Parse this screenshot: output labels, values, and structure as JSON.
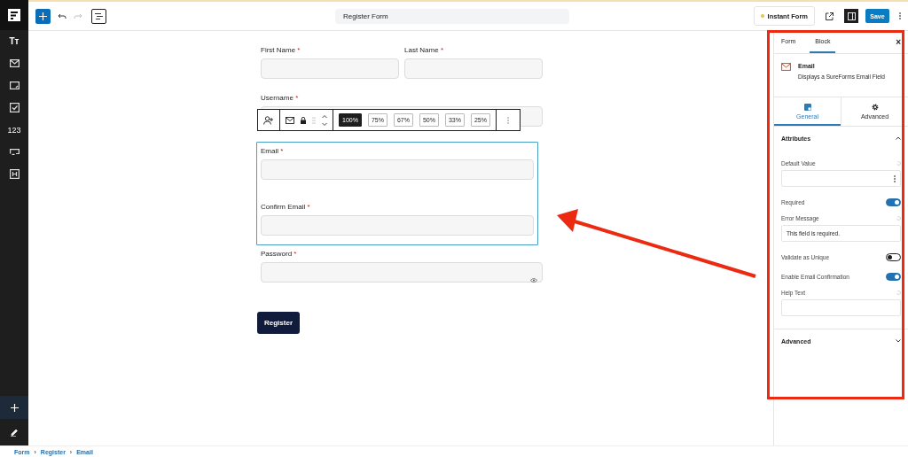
{
  "top_bar": {
    "title": "Register Form",
    "instant_form": "Instant Form",
    "save": "Save",
    "redo_disabled": true,
    "sidebar_toggle_on": true
  },
  "left_toolbar": {
    "text_glyph": "Tт",
    "number_glyph": "123"
  },
  "required_mark": "*",
  "form": {
    "rows": [
      {
        "kind": "pair",
        "fields": [
          {
            "label": "First Name",
            "required": true
          },
          {
            "label": "Last Name",
            "required": true
          }
        ]
      },
      {
        "kind": "field",
        "label": "Username",
        "required": true
      },
      {
        "kind": "selected_block",
        "fields": [
          {
            "label": "Email",
            "required": true
          },
          {
            "label": "Confirm Email",
            "required": true
          }
        ]
      },
      {
        "kind": "password",
        "label": "Password",
        "required": true
      }
    ],
    "submit": "Register"
  },
  "block_toolbar": {
    "widths": [
      {
        "label": "100%",
        "selected": true
      },
      {
        "label": "75%",
        "selected": false
      },
      {
        "label": "67%",
        "selected": false
      },
      {
        "label": "50%",
        "selected": false
      },
      {
        "label": "33%",
        "selected": false
      },
      {
        "label": "25%",
        "selected": false
      }
    ]
  },
  "panel": {
    "tabs": [
      {
        "label": "Form",
        "selected": false
      },
      {
        "label": "Block",
        "selected": true
      }
    ],
    "close": "×",
    "block": {
      "title": "Email",
      "description": "Displays a SureForms Email Field"
    },
    "subtabs": [
      {
        "label": "General",
        "selected": true
      },
      {
        "label": "Advanced",
        "selected": false
      }
    ],
    "sections": [
      {
        "title": "Attributes",
        "expanded": true,
        "settings": [
          {
            "kind": "field",
            "label": "Default Value",
            "menu": true
          },
          {
            "kind": "toggle",
            "label": "Required",
            "on": true
          },
          {
            "kind": "field",
            "label": "Error Message",
            "value": "This field is required.",
            "menu": false
          },
          {
            "kind": "toggle",
            "label": "Validate as Unique",
            "on": false
          },
          {
            "kind": "toggle",
            "label": "Enable Email Confirmation",
            "on": true
          },
          {
            "kind": "field",
            "label": "Help Text",
            "menu": false
          }
        ]
      },
      {
        "title": "Advanced",
        "expanded": false
      }
    ]
  },
  "breadcrumbs": [
    "Form",
    "›",
    "Register",
    "›",
    "Email"
  ]
}
